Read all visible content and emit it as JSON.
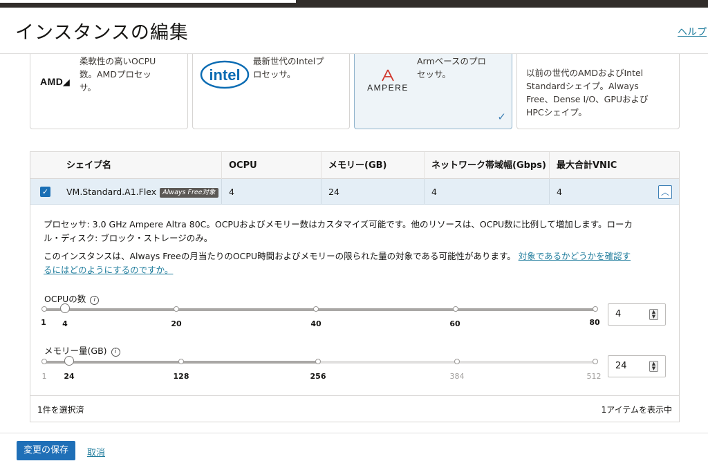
{
  "header": {
    "title": "インスタンスの編集",
    "help": "ヘルプ"
  },
  "cards": [
    {
      "brand": "AMD",
      "desc_lines": [
        "柔軟性の高いOCPU",
        "数。AMDプロセッ",
        "サ。"
      ],
      "selected": false
    },
    {
      "brand": "intel",
      "desc_lines": [
        "最新世代のIntelプ",
        "ロセッサ。"
      ],
      "selected": false
    },
    {
      "brand": "AMPERE",
      "desc_lines": [
        "Armベースのプロ",
        "セッサ。"
      ],
      "selected": true
    },
    {
      "brand": "",
      "desc_lines": [
        "以前の世代のAMDおよびIntel",
        "Standardシェイプ。Always",
        "Free、Dense I/O、GPUおよび",
        "HPCシェイプ。"
      ],
      "selected": false
    }
  ],
  "table": {
    "columns": [
      "シェイプ名",
      "OCPU",
      "メモリー(GB)",
      "ネットワーク帯域幅(Gbps)",
      "最大合計VNIC"
    ],
    "row": {
      "shape": "VM.Standard.A1.Flex",
      "badge": "Always Free対象",
      "ocpu": "4",
      "memory": "24",
      "bandwidth": "4",
      "vnic": "4",
      "selected": true
    },
    "detail": {
      "line1": "プロセッサ: 3.0 GHz Ampere Altra 80C。OCPUおよびメモリー数はカスタマイズ可能です。他のリソースは、OCPU数に比例して増加します。ローカ",
      "line2": "ル・ディスク: ブロック・ストレージのみ。",
      "line3": "このインスタンスは、Always Freeの月当たりのOCPU時間およびメモリーの限られた量の対象である可能性があります。",
      "link1": "対象であるかどうかを確認す",
      "link2": "るにはどのようにするのですか。"
    },
    "ocpu_slider": {
      "label": "OCPUの数",
      "info_icon": "info-icon",
      "min": "1",
      "ticks": [
        "4",
        "20",
        "40",
        "60",
        "80"
      ],
      "value": "4"
    },
    "memory_slider": {
      "label": "メモリー量(GB)",
      "info_icon": "info-icon",
      "min": "1",
      "ticks": [
        "24",
        "128",
        "256",
        "384",
        "512"
      ],
      "value": "24"
    },
    "footer": {
      "selected": "1件を選択済",
      "showing": "1アイテムを表示中"
    }
  },
  "actions": {
    "save": "変更の保存",
    "cancel": "取消"
  },
  "colors": {
    "accent": "#1f6fb7",
    "link": "#227e9e",
    "selected_row": "#e4eef6"
  }
}
